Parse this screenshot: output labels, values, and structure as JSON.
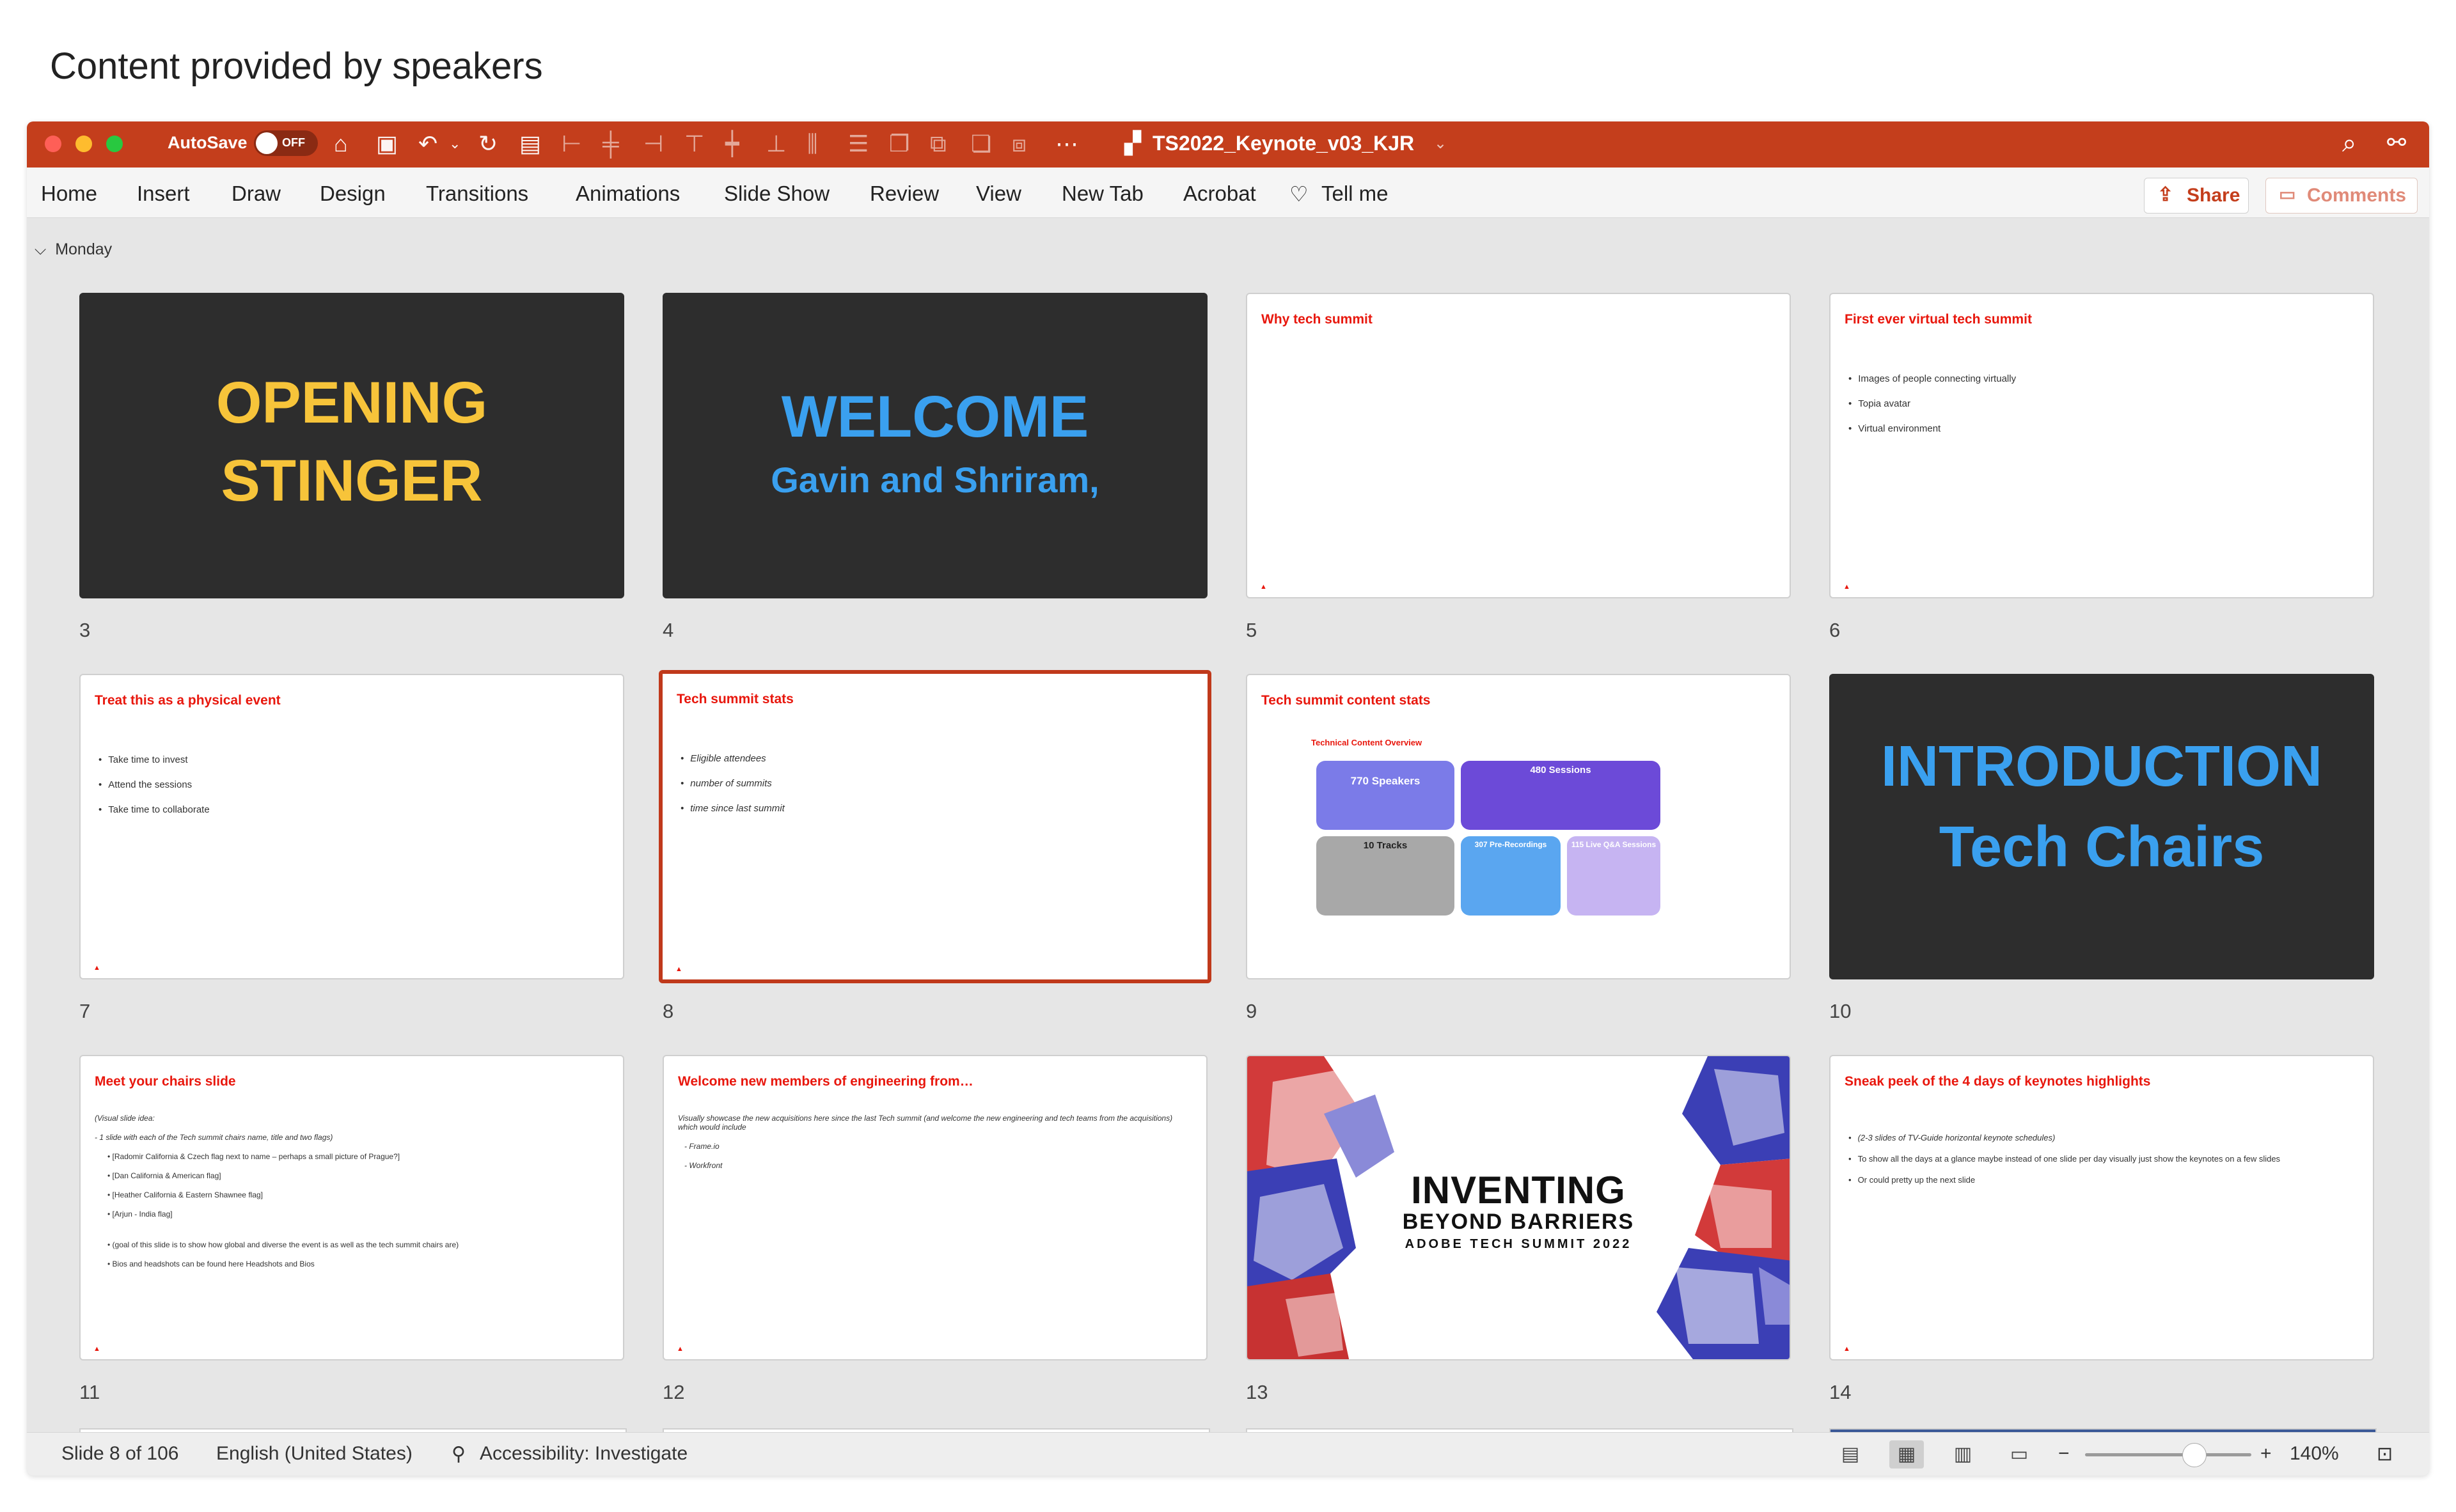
{
  "caption": "Content provided by speakers",
  "titlebar": {
    "autosave_label": "AutoSave",
    "autosave_state": "OFF",
    "doc_title": "TS2022_Keynote_v03_KJR"
  },
  "ribbon": {
    "tabs": [
      "Home",
      "Insert",
      "Draw",
      "Design",
      "Transitions",
      "Animations",
      "Slide Show",
      "Review",
      "View",
      "New Tab",
      "Acrobat",
      "Tell me"
    ],
    "share_label": "Share",
    "comments_label": "Comments"
  },
  "section_label": "Monday",
  "slides": {
    "s3": {
      "number": "3",
      "line1": "OPENING",
      "line2": "STINGER"
    },
    "s4": {
      "number": "4",
      "line1": "WELCOME",
      "line2": "Gavin and Shriram,"
    },
    "s5": {
      "number": "5",
      "title": "Why tech summit"
    },
    "s6": {
      "number": "6",
      "title": "First ever virtual tech summit",
      "bullets": [
        "Images of people connecting virtually",
        "Topia avatar",
        "Virtual environment"
      ]
    },
    "s7": {
      "number": "7",
      "title": "Treat this as a physical event",
      "bullets": [
        "Take time to invest",
        "Attend the sessions",
        "Take time to collaborate"
      ]
    },
    "s8": {
      "number": "8",
      "title": "Tech summit stats",
      "bullets": [
        "Eligible attendees",
        "number of summits",
        "time since last summit"
      ]
    },
    "s9": {
      "number": "9",
      "title": "Tech summit content stats",
      "subtitle": "Technical Content Overview",
      "box1": "770 Speakers",
      "box2": "480 Sessions",
      "box3": "10 Tracks",
      "box4": "307 Pre-Recordings",
      "box5": "115 Live Q&A Sessions"
    },
    "s10": {
      "number": "10",
      "line1": "INTRODUCTION",
      "line2": "Tech Chairs"
    },
    "s11": {
      "number": "11",
      "title": "Meet your chairs slide",
      "lines": [
        "(Visual slide idea:",
        "- 1 slide with each of the Tech summit chairs name, title and two flags)",
        "• [Radomir California & Czech flag next to name – perhaps a small picture of Prague?]",
        "• [Dan California & American flag]",
        "• [Heather California & Eastern Shawnee flag]",
        "• [Arjun - India flag]",
        "• (goal of this slide is to show how global and diverse the event is as well as the tech summit chairs are)",
        "• Bios and headshots can be found here Headshots and Bios"
      ]
    },
    "s12": {
      "number": "12",
      "title": "Welcome new members of engineering from…",
      "lines": [
        "Visually showcase the new acquisitions here since the last Tech summit (and welcome the new engineering and tech teams from the acquisitions) which would include",
        "- Frame.io",
        "- Workfront"
      ]
    },
    "s13": {
      "number": "13",
      "line1": "INVENTING",
      "line2": "BEYOND BARRIERS",
      "line3": "ADOBE TECH SUMMIT 2022"
    },
    "s14": {
      "number": "14",
      "title": "Sneak peek of the 4 days of keynotes highlights",
      "bullets": [
        "(2-3 slides of TV-Guide horizontal keynote schedules)",
        "To show all the days at a glance maybe instead of one slide per day visually just show the keynotes on a few slides",
        "Or could pretty up the next slide"
      ]
    }
  },
  "statusbar": {
    "slide_info": "Slide 8 of 106",
    "language": "English (United States)",
    "accessibility": "Accessibility: Investigate",
    "zoom": "140%"
  },
  "colors": {
    "titlebar": "#c43e1c",
    "slide_title": "#e8170d",
    "yellow": "#f7c43a",
    "blue": "#3aa0ef"
  }
}
